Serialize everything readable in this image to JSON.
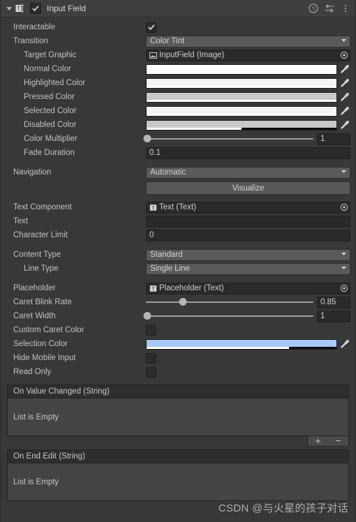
{
  "header": {
    "title": "Input Field",
    "enabled_checkbox": true,
    "foldout_icon": "triangle-down-icon",
    "component_icon": "input-field-icon",
    "help_icon": "help-icon",
    "preset_icon": "preset-settings-icon",
    "menu_icon": "kebab-menu-icon"
  },
  "properties": {
    "interactable": {
      "label": "Interactable",
      "checked": true
    },
    "transition": {
      "label": "Transition",
      "value": "Color Tint"
    },
    "target_graphic": {
      "label": "Target Graphic",
      "value": "InputField (Image)",
      "icon": "image-component-icon"
    },
    "normal_color": {
      "label": "Normal Color",
      "color": "#ffffff",
      "alpha": 100
    },
    "highlighted_color": {
      "label": "Highlighted Color",
      "color": "#f5f5f5",
      "alpha": 100
    },
    "pressed_color": {
      "label": "Pressed Color",
      "color": "#c8c8c8",
      "alpha": 100
    },
    "selected_color": {
      "label": "Selected Color",
      "color": "#f5f5f5",
      "alpha": 100
    },
    "disabled_color": {
      "label": "Disabled Color",
      "color": "#c8c8c8",
      "alpha": 50
    },
    "color_multiplier": {
      "label": "Color Multiplier",
      "value": "1",
      "slider_pct": 1
    },
    "fade_duration": {
      "label": "Fade Duration",
      "value": "0.1"
    },
    "navigation": {
      "label": "Navigation",
      "value": "Automatic"
    },
    "visualize": {
      "label": "Visualize"
    },
    "text_component": {
      "label": "Text Component",
      "value": "Text (Text)",
      "icon": "text-component-icon"
    },
    "text": {
      "label": "Text",
      "value": ""
    },
    "character_limit": {
      "label": "Character Limit",
      "value": "0"
    },
    "content_type": {
      "label": "Content Type",
      "value": "Standard"
    },
    "line_type": {
      "label": "Line Type",
      "value": "Single Line"
    },
    "placeholder": {
      "label": "Placeholder",
      "value": "Placeholder (Text)",
      "icon": "text-component-icon"
    },
    "caret_blink_rate": {
      "label": "Caret Blink Rate",
      "value": "0.85",
      "slider_pct": 22
    },
    "caret_width": {
      "label": "Caret Width",
      "value": "1",
      "slider_pct": 1
    },
    "custom_caret_color": {
      "label": "Custom Caret Color",
      "checked": false
    },
    "selection_color": {
      "label": "Selection Color",
      "color": "#a8c8f8",
      "alpha": 75
    },
    "hide_mobile_input": {
      "label": "Hide Mobile Input",
      "checked": false
    },
    "read_only": {
      "label": "Read Only",
      "checked": false
    }
  },
  "events": [
    {
      "title": "On Value Changed (String)",
      "empty_text": "List is Empty",
      "add_label": "+",
      "remove_label": "−"
    },
    {
      "title": "On End Edit (String)",
      "empty_text": "List is Empty"
    }
  ],
  "watermark": "CSDN @与火星的孩子对话"
}
